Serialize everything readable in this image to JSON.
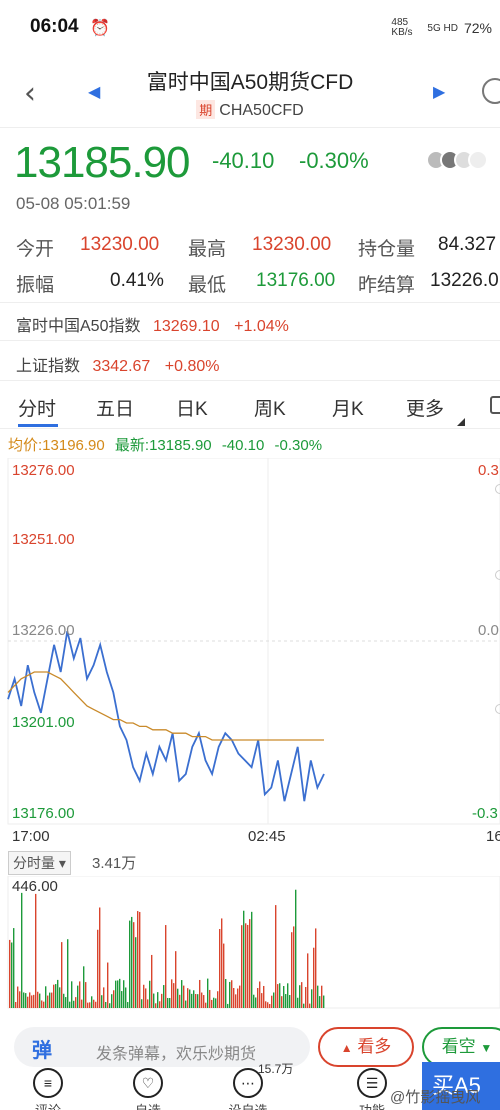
{
  "status": {
    "time": "06:04",
    "net_speed": "485 KB/s",
    "signal": "5G HD",
    "battery": "72%"
  },
  "nav": {
    "title": "富时中国A50期货CFD",
    "tag": "期",
    "code": "CHA50CFD"
  },
  "quote": {
    "price": "13185.90",
    "change": "-40.10",
    "change_pct": "-0.30%",
    "time": "05-08 05:01:59",
    "open_label": "今开",
    "open": "13230.00",
    "high_label": "最高",
    "high": "13230.00",
    "oi_label": "持仓量",
    "oi": "84.327",
    "amp_label": "振幅",
    "amp": "0.41%",
    "low_label": "最低",
    "low": "13176.00",
    "prev_label": "昨结算",
    "prev": "13226.0"
  },
  "indices": [
    {
      "name": "富时中国A50指数",
      "value": "13269.10",
      "pct": "+1.04%"
    },
    {
      "name": "上证指数",
      "value": "3342.67",
      "pct": "+0.80%"
    }
  ],
  "tabs": [
    "分时",
    "五日",
    "日K",
    "周K",
    "月K",
    "更多"
  ],
  "chart_info": {
    "avg": "均价:13196.90",
    "latest": "最新:13185.90",
    "chg": "-40.10",
    "pct": "-0.30%"
  },
  "chart_data": {
    "type": "line",
    "y_ticks": [
      "13276.00",
      "13251.00",
      "13226.00",
      "13201.00",
      "13176.00"
    ],
    "right_ticks": [
      "0.3",
      "0.0",
      "-0.3"
    ],
    "x_ticks": [
      "17:00",
      "02:45",
      "16"
    ],
    "ylim": [
      13176,
      13276
    ],
    "series": [
      {
        "values": [
          13208,
          13214,
          13206,
          13218,
          13210,
          13204,
          13214,
          13224,
          13216,
          13228,
          13220,
          13226,
          13214,
          13218,
          13224,
          13216,
          13210,
          13200,
          13196,
          13188,
          13184,
          13192,
          13186,
          13194,
          13190,
          13198,
          13184,
          13186,
          13194,
          13198,
          13190,
          13186,
          13194,
          13198,
          13196,
          13192,
          13190,
          13188,
          13196,
          13180,
          13182,
          13190,
          13178,
          13186,
          13194,
          13178,
          13190,
          13182,
          13186
        ]
      },
      {
        "values": [
          13210,
          13212,
          13214,
          13215,
          13216,
          13216,
          13216,
          13215,
          13214,
          13212,
          13210,
          13208,
          13206,
          13205,
          13204,
          13203,
          13202,
          13202,
          13201,
          13201,
          13200,
          13200,
          13199,
          13199,
          13199,
          13198,
          13198,
          13198,
          13197,
          13197,
          13197,
          13196,
          13196,
          13196,
          13196,
          13196,
          13196,
          13196,
          13196,
          13196,
          13196,
          13196,
          13196,
          13196,
          13196,
          13196,
          13196,
          13196,
          13196
        ]
      }
    ]
  },
  "volume": {
    "selector": "分时量",
    "value": "3.41万",
    "max_label": "446.00"
  },
  "bottom": {
    "comment_icon": "弹",
    "comment_placeholder": "发条弹幕，欢乐炒期货",
    "bull": "看多",
    "bear": "看空",
    "buy": "买A5",
    "nav": [
      "评论",
      "自选",
      "设自选",
      "功能"
    ],
    "badge": "15.7万",
    "watermark": "@竹影摇曳风"
  },
  "colors": {
    "up": "#d9442d",
    "down": "#1d9a3a",
    "accent": "#2f6fe0"
  }
}
